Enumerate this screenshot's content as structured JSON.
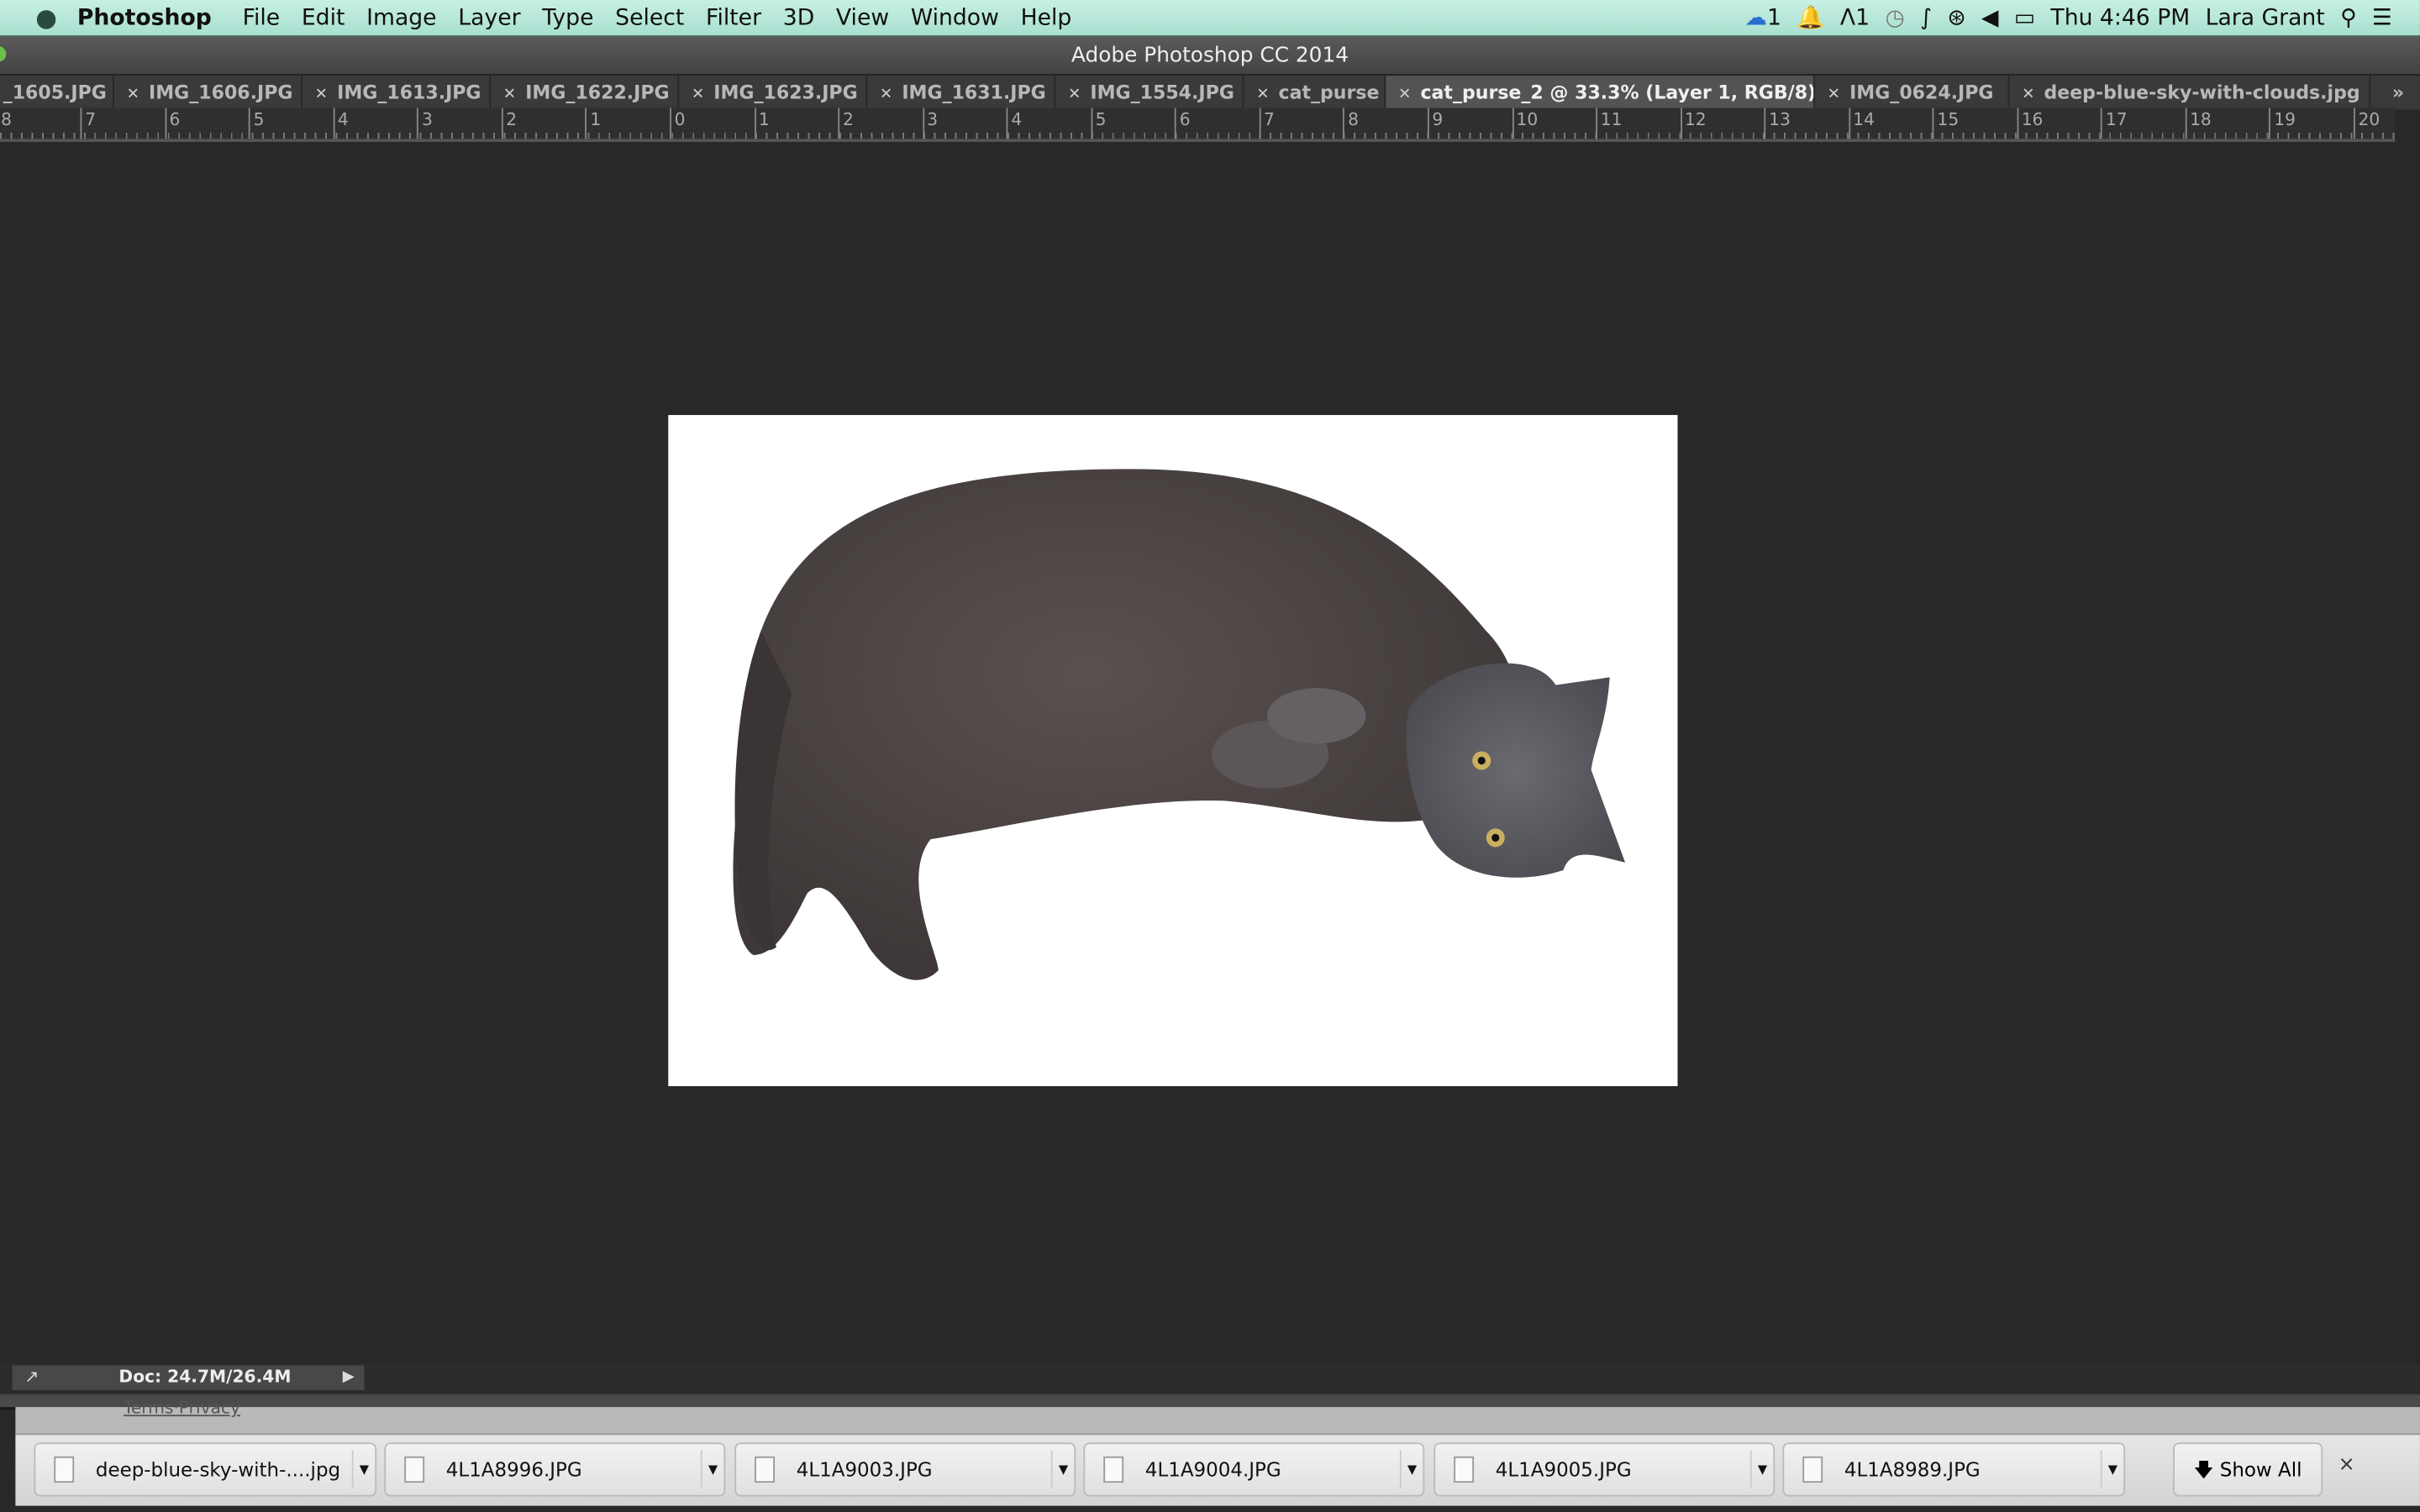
{
  "menubar": {
    "app": "Photoshop",
    "items": [
      "File",
      "Edit",
      "Image",
      "Layer",
      "Type",
      "Select",
      "Filter",
      "3D",
      "View",
      "Window",
      "Help"
    ],
    "status": {
      "cc_count": "1",
      "adobe_count": "1",
      "clock": "Thu 4:46 PM",
      "user": "Lara Grant"
    }
  },
  "window": {
    "title": "Adobe Photoshop CC 2014"
  },
  "tabs": [
    {
      "label": "_1605.JPG",
      "close": false
    },
    {
      "label": "IMG_1606.JPG",
      "close": true
    },
    {
      "label": "IMG_1613.JPG",
      "close": true
    },
    {
      "label": "IMG_1622.JPG",
      "close": true
    },
    {
      "label": "IMG_1623.JPG",
      "close": true
    },
    {
      "label": "IMG_1631.JPG",
      "close": true
    },
    {
      "label": "IMG_1554.JPG",
      "close": true
    },
    {
      "label": "cat_purse",
      "close": true
    },
    {
      "label": "cat_purse_2 @ 33.3% (Layer 1, RGB/8) *",
      "close": true,
      "active": true
    },
    {
      "label": "IMG_0624.JPG",
      "close": true
    },
    {
      "label": "deep-blue-sky-with-clouds.jpg",
      "close": true
    }
  ],
  "tabs_overflow": "»",
  "ruler": {
    "labels": [
      "8",
      "7",
      "6",
      "5",
      "4",
      "3",
      "2",
      "1",
      "0",
      "1",
      "2",
      "3",
      "4",
      "5",
      "6",
      "7",
      "8",
      "9",
      "10",
      "11",
      "12",
      "13",
      "14",
      "15",
      "16",
      "17",
      "18",
      "19",
      "20"
    ]
  },
  "statusbar": {
    "doc": "Doc: 24.7M/26.4M"
  },
  "web_peek": {
    "link": "Terms·Privacy"
  },
  "downloads": {
    "items": [
      "deep-blue-sky-with-....jpg",
      "4L1A8996.JPG",
      "4L1A9003.JPG",
      "4L1A9004.JPG",
      "4L1A9005.JPG",
      "4L1A8989.JPG"
    ],
    "show_all": "Show All",
    "close": "×"
  }
}
